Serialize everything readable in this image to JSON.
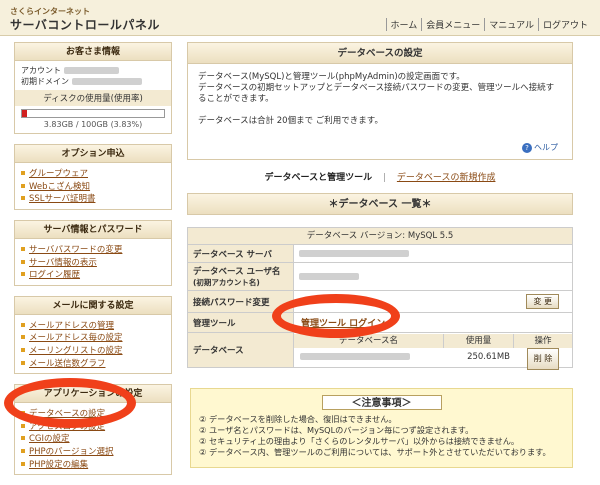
{
  "header": {
    "logo_sub": "さくらインターネット",
    "logo_main": "サーバコントロールパネル",
    "nav": [
      "ホーム",
      "会員メニュー",
      "マニュアル",
      "ログアウト"
    ]
  },
  "sidebar": {
    "customer": {
      "title": "お客さま情報",
      "account_label": "アカウント",
      "domain_label": "初期ドメイン",
      "disk_title": "ディスクの使用量(使用率)",
      "disk_usage_fraction": 0.0383,
      "disk_text": "3.83GB / 100GB (3.83%)"
    },
    "options": {
      "title": "オプション申込",
      "items": [
        "グループウェア",
        "Webこざん検知",
        "SSLサーバ証明書"
      ]
    },
    "server": {
      "title": "サーバ情報とパスワード",
      "items": [
        "サーバパスワードの変更",
        "サーバ情報の表示",
        "ログイン履歴"
      ]
    },
    "mail": {
      "title": "メールに関する設定",
      "items": [
        "メールアドレスの管理",
        "メールアドレス毎の設定",
        "メーリングリストの設定",
        "メール送信数グラフ"
      ]
    },
    "app": {
      "title": "アプリケーションの設定",
      "items": [
        "データベースの設定",
        "アクセスログの設定",
        "CGIの設定",
        "PHPのバージョン選択",
        "PHP設定の編集"
      ]
    }
  },
  "main": {
    "title": "データベースの設定",
    "intro_lines": [
      "データベース(MySQL)と管理ツール(phpMyAdmin)の設定画面です。",
      "データベースの初期セットアップとデータベース接続パスワードの変更、管理ツールへ接続することができます。",
      "",
      "データベースは合計 20個まで ご利用できます。"
    ],
    "help": "ヘルプ",
    "tab_active": "データベースと管理ツール",
    "tab_link": "データベースの新規作成",
    "list_title": "＊データベース 一覧＊",
    "table": {
      "caption": "データベース バージョン: MySQL 5.5",
      "server_label": "データベース サーバ",
      "user_label": "データベース ユーザ名",
      "user_sub": "(初期アカウント名)",
      "password_label": "接続パスワード変更",
      "change_button": "変 更",
      "tool_label": "管理ツール",
      "tool_link": "管理ツール ログイン",
      "db_label": "データベース",
      "col_db": "データベース名",
      "col_usage": "使用量",
      "col_action": "操作",
      "usage_value": "250.61MB",
      "delete_button": "削 除"
    },
    "notice": {
      "title": "＜注意事項＞",
      "items": [
        "データベースを削除した場合、復旧はできません。",
        "ユーザ名とパスワードは、MySQLのバージョン毎につず設定されます。",
        "セキュリティ上の理由より「さくらのレンタルサーバ」以外からは接続できません。",
        "データベース内、管理ツールのご利用については、サポート外とさせていただいております。"
      ]
    }
  }
}
